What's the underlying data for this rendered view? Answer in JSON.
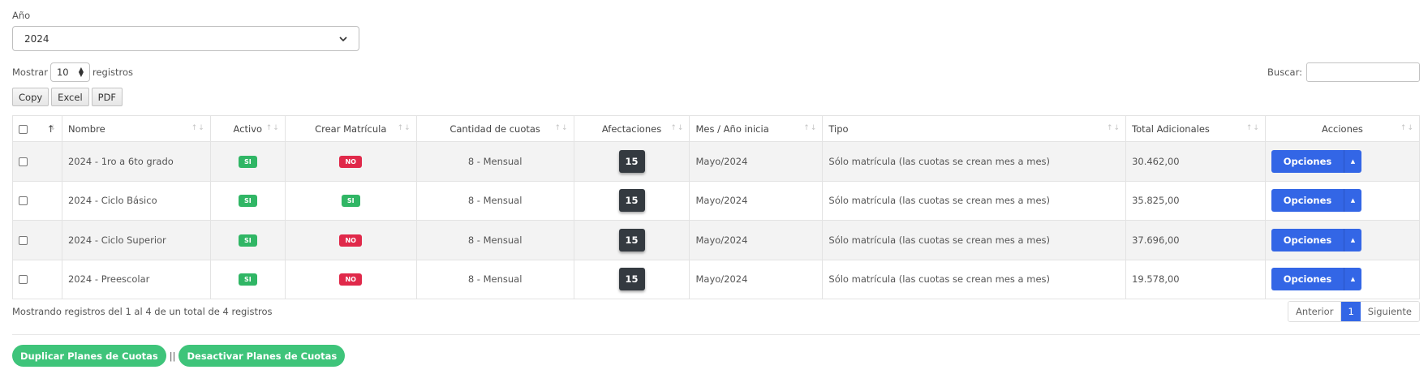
{
  "filter": {
    "year_label": "Año",
    "year_value": "2024"
  },
  "length_menu": {
    "prefix": "Mostrar",
    "value": "10",
    "suffix": "registros"
  },
  "search": {
    "label": "Buscar:",
    "value": ""
  },
  "export_buttons": [
    "Copy",
    "Excel",
    "PDF"
  ],
  "table": {
    "headers": {
      "sort_glyph": "↑",
      "nombre": "Nombre",
      "activo": "Activo",
      "crear_matricula": "Crear Matrícula",
      "cantidad_cuotas": "Cantidad de cuotas",
      "afectaciones": "Afectaciones",
      "mes_inicia": "Mes / Año inicia",
      "tipo": "Tipo",
      "total_adicionales": "Total Adicionales",
      "acciones": "Acciones"
    },
    "rows": [
      {
        "nombre": "2024 - 1ro a 6to grado",
        "activo": "SI",
        "crear_matricula": "NO",
        "cantidad_cuotas": "8 - Mensual",
        "afectaciones": "15",
        "mes_inicia": "Mayo/2024",
        "tipo": "Sólo matrícula (las cuotas se crean mes a mes)",
        "total_adicionales": "30.462,00",
        "accion": "Opciones"
      },
      {
        "nombre": "2024 - Ciclo Básico",
        "activo": "SI",
        "crear_matricula": "SI",
        "cantidad_cuotas": "8 - Mensual",
        "afectaciones": "15",
        "mes_inicia": "Mayo/2024",
        "tipo": "Sólo matrícula (las cuotas se crean mes a mes)",
        "total_adicionales": "35.825,00",
        "accion": "Opciones"
      },
      {
        "nombre": "2024 - Ciclo Superior",
        "activo": "SI",
        "crear_matricula": "NO",
        "cantidad_cuotas": "8 - Mensual",
        "afectaciones": "15",
        "mes_inicia": "Mayo/2024",
        "tipo": "Sólo matrícula (las cuotas se crean mes a mes)",
        "total_adicionales": "37.696,00",
        "accion": "Opciones"
      },
      {
        "nombre": "2024 - Preescolar",
        "activo": "SI",
        "crear_matricula": "NO",
        "cantidad_cuotas": "8 - Mensual",
        "afectaciones": "15",
        "mes_inicia": "Mayo/2024",
        "tipo": "Sólo matrícula (las cuotas se crean mes a mes)",
        "total_adicionales": "19.578,00",
        "accion": "Opciones"
      }
    ]
  },
  "info_text": "Mostrando registros del 1 al 4 de un total de 4 registros",
  "pagination": {
    "prev": "Anterior",
    "current": "1",
    "next": "Siguiente"
  },
  "actions": {
    "duplicate": "Duplicar Planes de Cuotas",
    "separator": "||",
    "deactivate": "Desactivar Planes de Cuotas"
  },
  "colors": {
    "primary": "#3366e6",
    "success": "#30b665",
    "danger": "#e0294a",
    "dark": "#343a40",
    "green_button": "#3ec47a"
  }
}
